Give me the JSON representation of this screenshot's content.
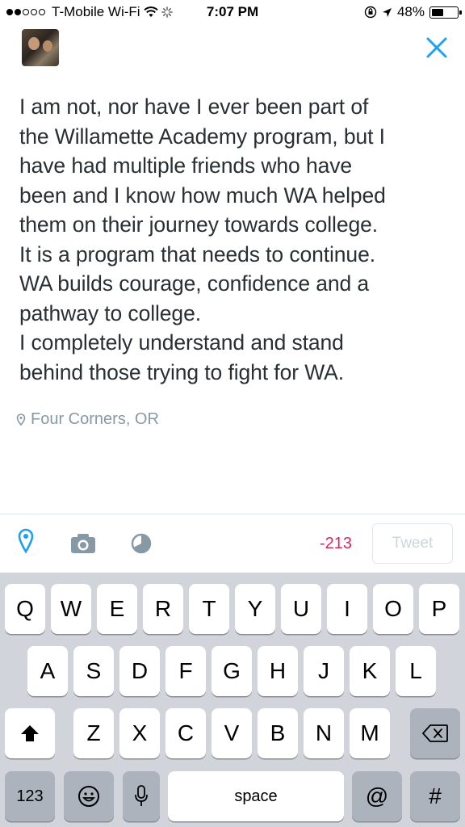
{
  "status_bar": {
    "carrier": "T-Mobile Wi-Fi",
    "time": "7:07 PM",
    "battery_percent": "48%",
    "battery_level": 0.48,
    "signal_dots_filled": 2,
    "signal_dots_total": 5
  },
  "compose": {
    "tweet_text": "I am not, nor have I ever been part of\nthe Willamette Academy program, but I\nhave had multiple friends who have\nbeen and I know how much WA helped\nthem on their journey towards college.\nIt is a program that needs to continue.\nWA builds courage, confidence and a\npathway to college.\nI completely understand and stand\nbehind those trying to fight for WA.",
    "location": "Four Corners, OR"
  },
  "toolbar": {
    "char_count": "-213",
    "tweet_button": "Tweet"
  },
  "keyboard": {
    "row1": [
      "Q",
      "W",
      "E",
      "R",
      "T",
      "Y",
      "U",
      "I",
      "O",
      "P"
    ],
    "row2": [
      "A",
      "S",
      "D",
      "F",
      "G",
      "H",
      "J",
      "K",
      "L"
    ],
    "row3": [
      "Z",
      "X",
      "C",
      "V",
      "B",
      "N",
      "M"
    ],
    "numbers_key": "123",
    "space_key": "space",
    "at_key": "@",
    "hash_key": "#"
  },
  "colors": {
    "accent": "#1da1f2",
    "count_negative": "#e0245e",
    "text": "#292f33",
    "muted": "#8899a6",
    "icon_gray": "#8899a6"
  }
}
